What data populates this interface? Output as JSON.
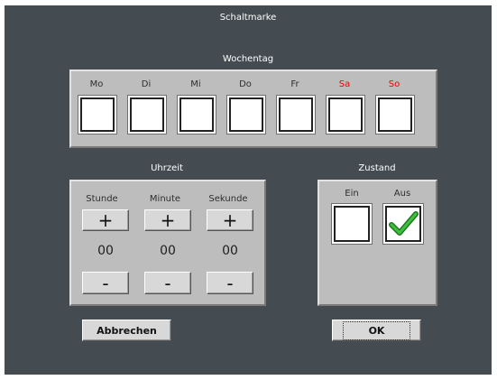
{
  "window": {
    "title": "Schaltmarke"
  },
  "weekday": {
    "heading": "Wochentag",
    "days": [
      {
        "label": "Mo",
        "checked": false,
        "weekend": false
      },
      {
        "label": "Di",
        "checked": false,
        "weekend": false
      },
      {
        "label": "Mi",
        "checked": false,
        "weekend": false
      },
      {
        "label": "Do",
        "checked": false,
        "weekend": false
      },
      {
        "label": "Fr",
        "checked": false,
        "weekend": false
      },
      {
        "label": "Sa",
        "checked": false,
        "weekend": true
      },
      {
        "label": "So",
        "checked": false,
        "weekend": true
      }
    ],
    "weekend_color": "#ee0000"
  },
  "time": {
    "heading": "Uhrzeit",
    "increment_label": "+",
    "decrement_label": "-",
    "fields": [
      {
        "label": "Stunde",
        "value": "00"
      },
      {
        "label": "Minute",
        "value": "00"
      },
      {
        "label": "Sekunde",
        "value": "00"
      }
    ]
  },
  "state": {
    "heading": "Zustand",
    "on_label": "Ein",
    "off_label": "Aus",
    "on_checked": false,
    "off_checked": true,
    "check_color": "#2a9d2a"
  },
  "buttons": {
    "cancel": "Abbrechen",
    "ok": "OK"
  },
  "colors": {
    "window_bg": "#444c51",
    "panel_bg": "#bdbdbd",
    "button_bg": "#d8d8d8"
  }
}
